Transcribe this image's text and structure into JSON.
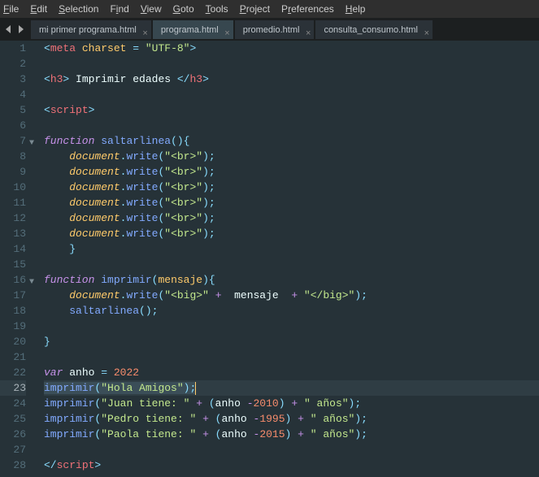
{
  "menu": {
    "file": "File",
    "edit": "Edit",
    "selection": "Selection",
    "find": "Find",
    "view": "View",
    "goto": "Goto",
    "tools": "Tools",
    "project": "Project",
    "preferences": "Preferences",
    "help": "Help"
  },
  "tabs": {
    "t0": "mi primer programa.html",
    "t1": "programa.html",
    "t2": "promedio.html",
    "t3": "consulta_consumo.html"
  },
  "lines": {
    "n1": "1",
    "n2": "2",
    "n3": "3",
    "n4": "4",
    "n5": "5",
    "n6": "6",
    "n7": "7",
    "n8": "8",
    "n9": "9",
    "n10": "10",
    "n11": "11",
    "n12": "12",
    "n13": "13",
    "n14": "14",
    "n15": "15",
    "n16": "16",
    "n17": "17",
    "n18": "18",
    "n19": "19",
    "n20": "20",
    "n21": "21",
    "n22": "22",
    "n23": "23",
    "n24": "24",
    "n25": "25",
    "n26": "26",
    "n27": "27",
    "n28": "28"
  },
  "code": {
    "l1": {
      "meta": "meta",
      "charset": "charset",
      "eq": " = ",
      "val": "\"UTF-8\""
    },
    "l3": {
      "h3o": "h3",
      "txt": " Imprimir edades ",
      "h3c": "h3"
    },
    "l5": {
      "script": "script"
    },
    "l7": {
      "fn_kw": "function",
      "name": "saltarlinea"
    },
    "doc_lines": {
      "document": "document",
      "write": "write",
      "br": "\"<br>\""
    },
    "l16": {
      "fn_kw": "function",
      "name": "imprimir",
      "param": "mensaje"
    },
    "l17": {
      "document": "document",
      "write": "write",
      "bigo": "\"<big>\"",
      "plus": " + ",
      "mensaje": " mensaje ",
      "bigc": "\"</big>\""
    },
    "l18": {
      "call": "saltarlinea"
    },
    "l22": {
      "var": "var",
      "name": "anho",
      "eq": " = ",
      "val": "2022"
    },
    "l23": {
      "fn": "imprimir",
      "str": "\"Hola Amigos\""
    },
    "l24": {
      "fn": "imprimir",
      "s1": "\"Juan tiene: \"",
      "plus": " + ",
      "anho": "anho ",
      "minus": "-",
      "y": "2010",
      "s2": "\" años\""
    },
    "l25": {
      "fn": "imprimir",
      "s1": "\"Pedro tiene: \"",
      "plus": " + ",
      "anho": "anho ",
      "minus": "-",
      "y": "1995",
      "s2": "\" años\""
    },
    "l26": {
      "fn": "imprimir",
      "s1": "\"Paola tiene: \"",
      "plus": " + ",
      "anho": "anho ",
      "minus": "-",
      "y": "2015",
      "s2": "\" años\""
    },
    "l28": {
      "script": "script"
    }
  }
}
